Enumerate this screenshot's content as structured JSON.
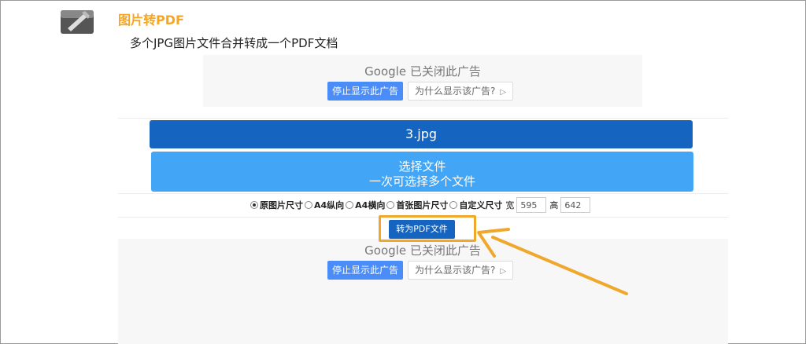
{
  "header": {
    "title": "图片转PDF",
    "subtitle": "多个JPG图片文件合并转成一个PDF文档",
    "icon": "pdf-tool-icon"
  },
  "ad_top": {
    "google_text": "Google 已关闭此广告",
    "stop_label": "停止显示此广告",
    "why_label": "为什么显示该广告?"
  },
  "file": {
    "name": "3.jpg"
  },
  "select": {
    "line1": "选择文件",
    "line2": "一次可选择多个文件"
  },
  "options": {
    "items": [
      {
        "label": "原图片尺寸",
        "selected": true
      },
      {
        "label": "A4纵向",
        "selected": false
      },
      {
        "label": "A4横向",
        "selected": false
      },
      {
        "label": "首张图片尺寸",
        "selected": false
      },
      {
        "label": "自定义尺寸",
        "selected": false
      }
    ],
    "width_label": "宽",
    "width_value": "595",
    "height_label": "高",
    "height_value": "642"
  },
  "convert_label": "转为PDF文件",
  "ad_bottom": {
    "google_text": "Google 已关闭此广告",
    "stop_label": "停止显示此广告",
    "why_label": "为什么显示该广告?"
  },
  "colors": {
    "accent": "#f5a623",
    "primary": "#1565c0",
    "secondary": "#42a5f5",
    "highlight": "#f0a82c"
  }
}
